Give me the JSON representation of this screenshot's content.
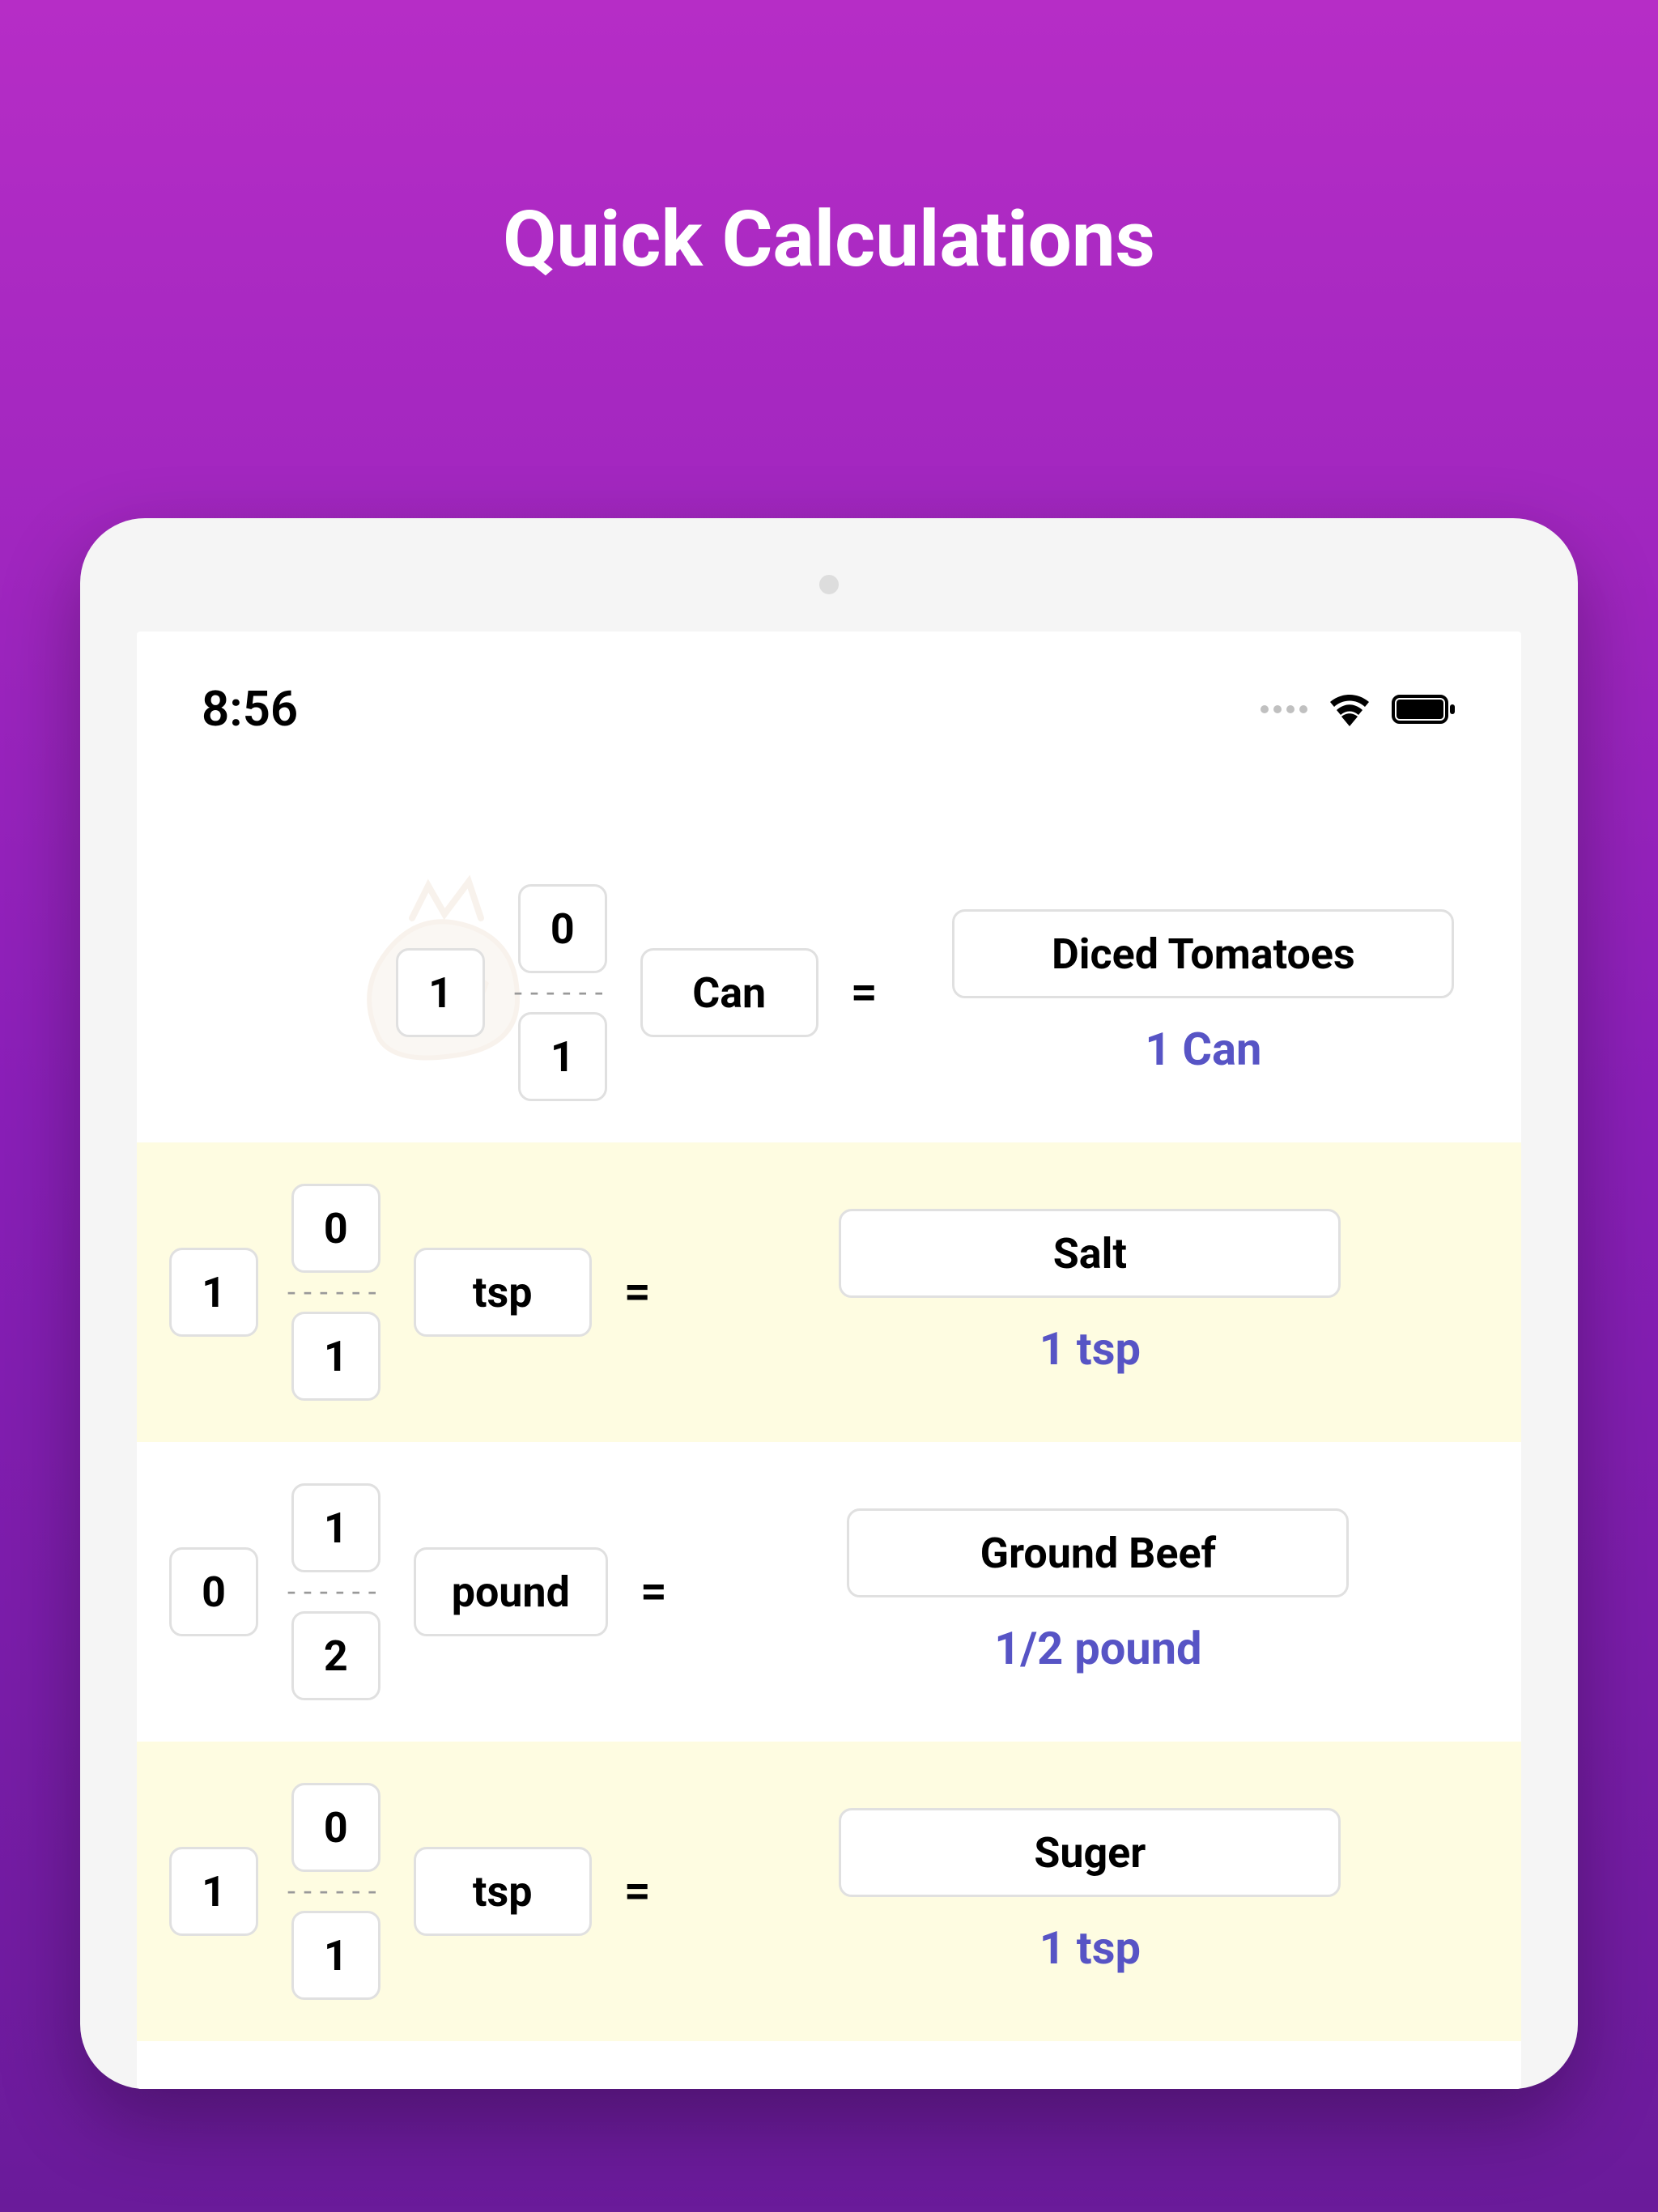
{
  "header": {
    "title": "Quick Calculations"
  },
  "statusbar": {
    "time": "8:56"
  },
  "rows": [
    {
      "whole": "1",
      "numerator": "0",
      "denominator": "1",
      "unit": "Can",
      "equals": "=",
      "ingredient": "Diced Tomatoes",
      "result": "1 Can"
    },
    {
      "whole": "1",
      "numerator": "0",
      "denominator": "1",
      "unit": "tsp",
      "equals": "=",
      "ingredient": "Salt",
      "result": "1 tsp"
    },
    {
      "whole": "0",
      "numerator": "1",
      "denominator": "2",
      "unit": "pound",
      "equals": "=",
      "ingredient": "Ground Beef",
      "result": "1/2 pound"
    },
    {
      "whole": "1",
      "numerator": "0",
      "denominator": "1",
      "unit": "tsp",
      "equals": "=",
      "ingredient": "Suger",
      "result": "1 tsp"
    }
  ]
}
